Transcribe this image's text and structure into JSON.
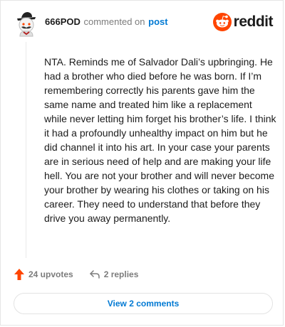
{
  "header": {
    "username": "666POD",
    "action_text": "commented on",
    "post_link": "post",
    "brand": "reddit"
  },
  "comment": {
    "text": "NTA. Reminds me of Salvador Dali’s upbringing. He had a brother who died before he was born. If I’m remembering correctly his parents gave him the same name and treated him like a replacement while never letting him forget his brother’s life. I think it had a profoundly unhealthy impact on him but he did channel it into his art. In your case your parents are in serious need of help and are making your life hell. You are not your brother and will never become your brother by wearing his clothes or taking on his career. They need to understand that before they drive you away permanently."
  },
  "actions": {
    "upvotes": "24 upvotes",
    "replies": "2 replies"
  },
  "footer": {
    "view_comments": "View 2 comments"
  },
  "icons": {
    "avatar": "snoo-avatar-icon",
    "brand": "reddit-logo-icon",
    "upvote": "upvote-arrow-icon",
    "reply": "reply-arrow-icon"
  },
  "colors": {
    "reddit_orange": "#ff4500",
    "link_blue": "#0079d3",
    "muted_text": "#7c7c7c",
    "text": "#1c1c1c"
  }
}
